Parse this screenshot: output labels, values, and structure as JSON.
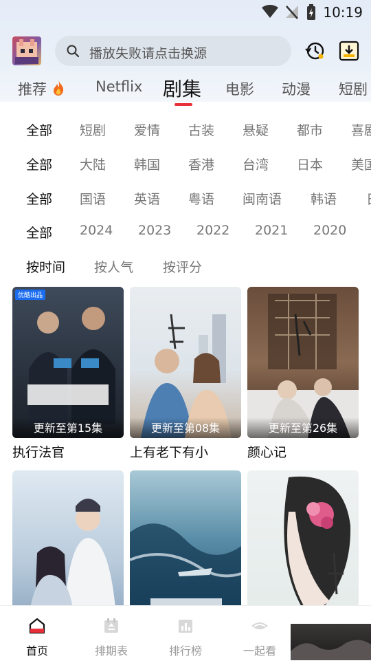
{
  "status_bar": {
    "time": "10:19"
  },
  "header": {
    "search_placeholder": "播放失败请点击换源"
  },
  "tabs": [
    {
      "label": "推荐"
    },
    {
      "label": "Netflix"
    },
    {
      "label": "剧集"
    },
    {
      "label": "电影"
    },
    {
      "label": "动漫"
    },
    {
      "label": "短剧"
    }
  ],
  "filters": {
    "genre": [
      "全部",
      "短剧",
      "爱情",
      "古装",
      "悬疑",
      "都市",
      "喜剧"
    ],
    "region": [
      "全部",
      "大陆",
      "韩国",
      "香港",
      "台湾",
      "日本",
      "美国"
    ],
    "language": [
      "全部",
      "国语",
      "英语",
      "粤语",
      "闽南语",
      "韩语",
      "日"
    ],
    "year": [
      "全部",
      "2024",
      "2023",
      "2022",
      "2021",
      "2020"
    ],
    "sort": [
      "按时间",
      "按人气",
      "按评分"
    ]
  },
  "cards": [
    {
      "title": "执行法官",
      "badge": "更新至第15集",
      "tag": "优酷出品"
    },
    {
      "title": "上有老下有小",
      "badge": "更新至第08集"
    },
    {
      "title": "颜心记",
      "badge": "更新至第26集"
    },
    {
      "title": ""
    },
    {
      "title": ""
    },
    {
      "title": ""
    }
  ],
  "bottom_nav": [
    {
      "label": "首页",
      "icon": "home-icon"
    },
    {
      "label": "排期表",
      "icon": "calendar-icon"
    },
    {
      "label": "排行榜",
      "icon": "ranking-icon"
    },
    {
      "label": "一起看",
      "icon": "watch-together-icon"
    }
  ],
  "colors": {
    "accent": "#e8303a",
    "header_bg": "#e6edf8",
    "search_bg": "#dde3ea"
  }
}
